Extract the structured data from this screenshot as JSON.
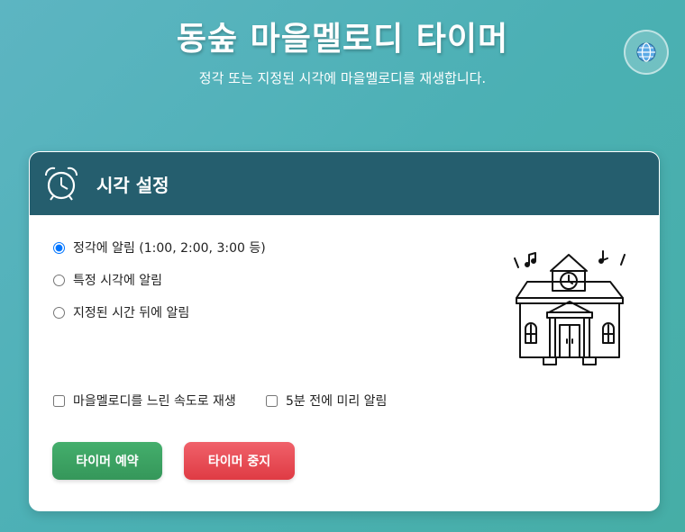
{
  "header": {
    "title": "동숲 마을멜로디 타이머",
    "subtitle": "정각 또는 지정된 시각에 마을멜로디를 재생합니다."
  },
  "language_button": {
    "icon": "globe-icon"
  },
  "card": {
    "title": "시각 설정",
    "icon": "alarm-clock-icon",
    "options": [
      {
        "label": "정각에 알림 (1:00, 2:00, 3:00 등)",
        "checked": true
      },
      {
        "label": "특정 시각에 알림",
        "checked": false
      },
      {
        "label": "지정된 시간 뒤에 알림",
        "checked": false
      }
    ],
    "checkboxes": [
      {
        "label": "마을멜로디를 느린 속도로 재생",
        "checked": false
      },
      {
        "label": "5분 전에 미리 알림",
        "checked": false
      }
    ],
    "buttons": {
      "reserve": "타이머 예약",
      "stop": "타이머 중지"
    },
    "illustration": "town-hall-illustration"
  },
  "colors": {
    "background": "#4bb0b4",
    "card_header": "#255e6e",
    "reserve_button": "#3aa062",
    "stop_button": "#e5474f"
  }
}
